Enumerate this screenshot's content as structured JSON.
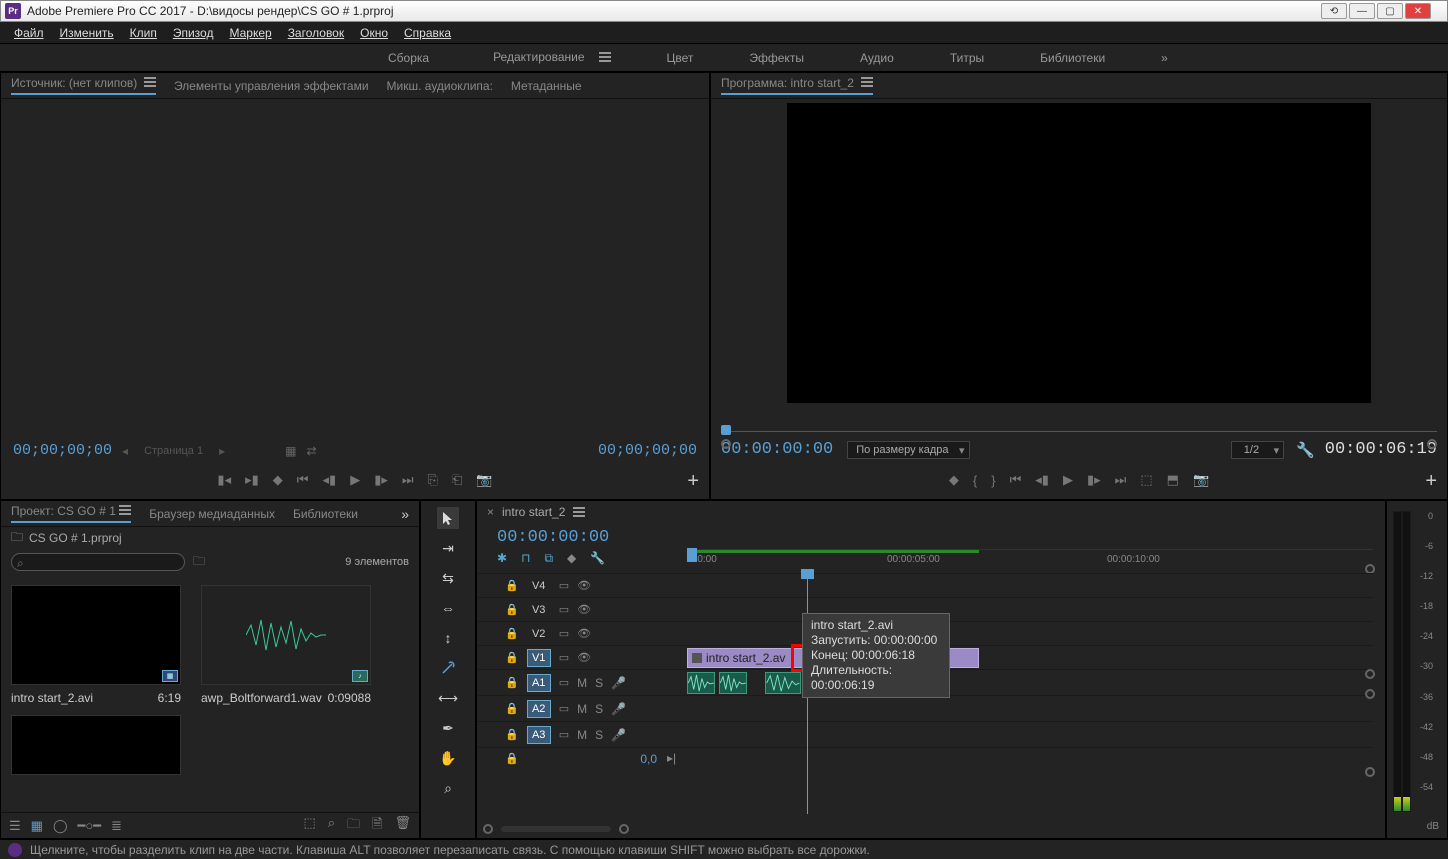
{
  "title": "Adobe Premiere Pro CC 2017 - D:\\видосы рендер\\CS GO # 1.prproj",
  "menu": [
    "Файл",
    "Изменить",
    "Клип",
    "Эпизод",
    "Маркер",
    "Заголовок",
    "Окно",
    "Справка"
  ],
  "workspaces": [
    "Сборка",
    "Редактирование",
    "Цвет",
    "Эффекты",
    "Аудио",
    "Титры",
    "Библиотеки"
  ],
  "workspace_active": 1,
  "source_tabs": [
    "Источник: (нет клипов)",
    "Элементы управления эффектами",
    "Микш. аудиоклипа:",
    "Метаданные"
  ],
  "source_tc_left": "00;00;00;00",
  "source_page": "Страница 1",
  "source_tc_right": "00;00;00;00",
  "program_title": "Программа: intro start_2",
  "program_tc_left": "00:00:00:00",
  "program_fit": "По размеру кадра",
  "program_res": "1/2",
  "program_tc_right": "00:00:06:19",
  "project_tabs": [
    "Проект: CS GO # 1",
    "Браузер медиаданных",
    "Библиотеки"
  ],
  "project_file": "CS GO # 1.prproj",
  "project_count": "9 элементов",
  "thumbs": [
    {
      "name": "intro start_2.avi",
      "dur": "6:19",
      "type": "video"
    },
    {
      "name": "awp_Boltforward1.wav",
      "dur": "0:09088",
      "type": "audio"
    }
  ],
  "timeline_tab": "intro start_2",
  "timeline_tc": "00:00:00:00",
  "ruler_marks": [
    ":00:00",
    "00:00:05:00",
    "00:00:10:00"
  ],
  "video_tracks": [
    "V4",
    "V3",
    "V2",
    "V1"
  ],
  "audio_tracks": [
    "A1",
    "A2",
    "A3"
  ],
  "v1_clip": "intro start_2.av",
  "pan_value": "0,0",
  "tooltip": {
    "file": "intro start_2.avi",
    "start": "Запустить: 00:00:00:00",
    "end": "Конец: 00:00:06:18",
    "dur": "Длительность: 00:00:06:19"
  },
  "meter_marks": [
    "0",
    "-6",
    "-12",
    "-18",
    "-24",
    "-30",
    "-36",
    "-42",
    "-48",
    "-54",
    ""
  ],
  "meter_label": "dB",
  "status": "Щелкните, чтобы разделить клип на две части. Клавиша ALT позволяет перезаписать связь. С помощью клавиши SHIFT можно выбрать все дорожки."
}
